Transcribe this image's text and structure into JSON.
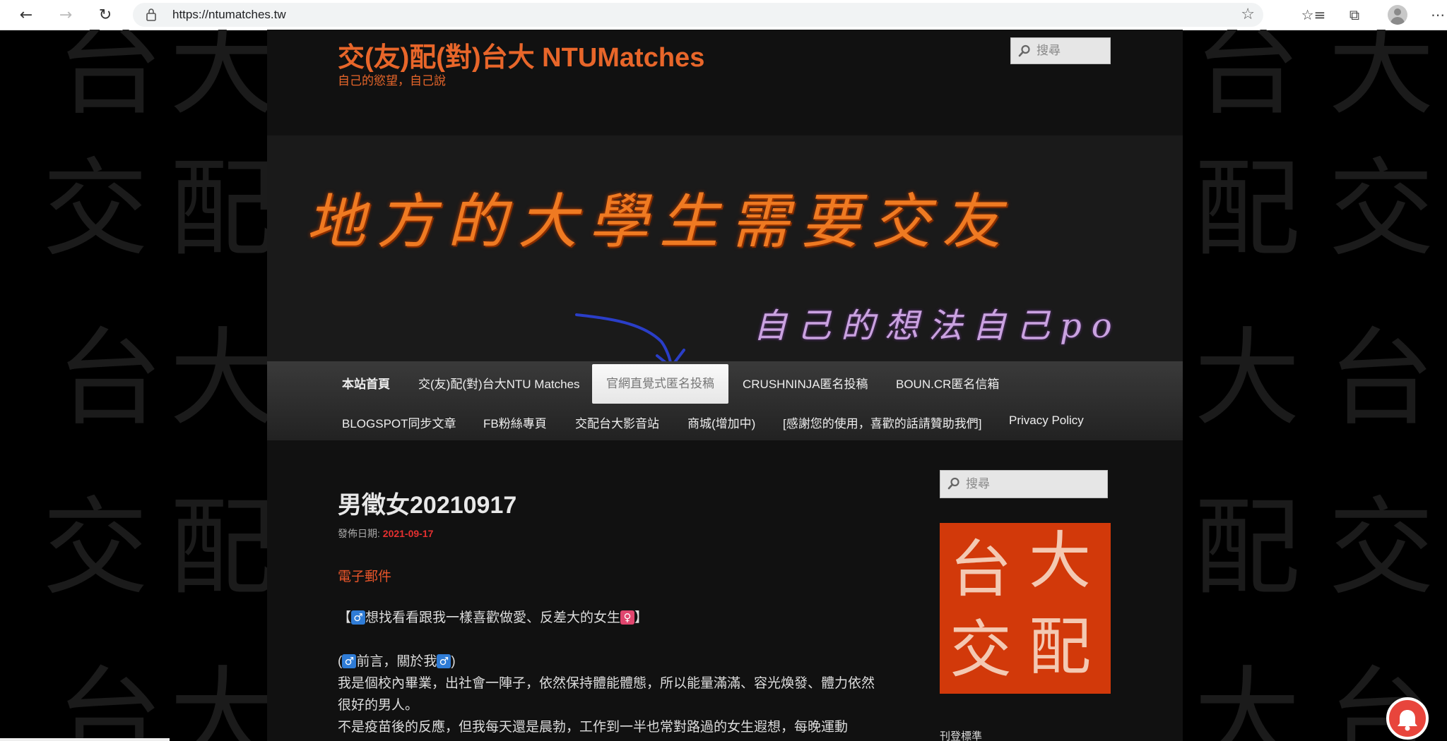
{
  "browser": {
    "url": "https://ntumatches.tw",
    "back_icon": "←",
    "forward_icon": "→",
    "reload_icon": "↻",
    "star_icon": "☆",
    "favorites_icon": "☆≡",
    "collections_icon": "⧉",
    "menu_icon": "⋯"
  },
  "site": {
    "title": "交(友)配(對)台大 NTUMatches",
    "description": "自己的慾望，自己說",
    "search_placeholder": "搜尋",
    "accent_color": "#e8662a"
  },
  "banner": {
    "main_text": "地方的大學生需要交友",
    "sub_text": "自己的想法自己po"
  },
  "nav": {
    "items": [
      {
        "label": "本站首頁"
      },
      {
        "label": "交(友)配(對)台大NTU Matches"
      },
      {
        "label": "官網直覺式匿名投稿"
      },
      {
        "label": "CRUSHNINJA匿名投稿"
      },
      {
        "label": "BOUN.CR匿名信箱"
      },
      {
        "label": "BLOGSPOT同步文章"
      },
      {
        "label": "FB粉絲專頁"
      },
      {
        "label": "交配台大影音站"
      },
      {
        "label": "商城(增加中)"
      },
      {
        "label": "[感謝您的使用，喜歡的話請贊助我們]"
      },
      {
        "label": "Privacy Policy"
      }
    ]
  },
  "post": {
    "title": "男徵女20210917",
    "meta_label": "發佈日期:",
    "date": "2021-09-17",
    "email_link": "電子郵件",
    "intro_open": "【",
    "intro_text": "想找看看跟我一樣喜歡做愛、反差大的女生",
    "intro_close": "】",
    "preface_open": "(",
    "preface_text": "前言，關於我",
    "preface_close": ")",
    "para1": "我是個校內畢業，出社會一陣子，依然保持體能體態，所以能量滿滿、容光煥發、體力依然很好的男人。",
    "para2": "不是疫苗後的反應，但我每天還是晨勃，工作到一半也常對路過的女生遐想，每晚運動"
  },
  "sidebar": {
    "search_placeholder": "搜尋",
    "logo_chars": [
      "台",
      "大",
      "交",
      "配"
    ],
    "heading": "刊登標準"
  }
}
